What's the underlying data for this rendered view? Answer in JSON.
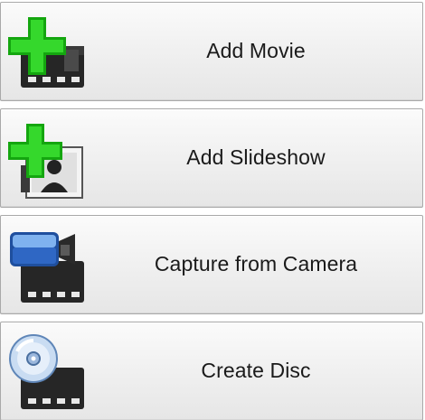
{
  "buttons": [
    {
      "id": "add-movie",
      "label": "Add Movie",
      "icon": "add-movie-icon"
    },
    {
      "id": "add-slideshow",
      "label": "Add Slideshow",
      "icon": "add-slideshow-icon"
    },
    {
      "id": "capture-from-camera",
      "label": "Capture from Camera",
      "icon": "camera-film-icon"
    },
    {
      "id": "create-disc",
      "label": "Create Disc",
      "icon": "disc-film-icon"
    }
  ],
  "colors": {
    "plus_green": "#22c51c",
    "film_dark": "#2b2b2b",
    "button_border": "#a9a9a9",
    "text": "#1a1a1a"
  }
}
